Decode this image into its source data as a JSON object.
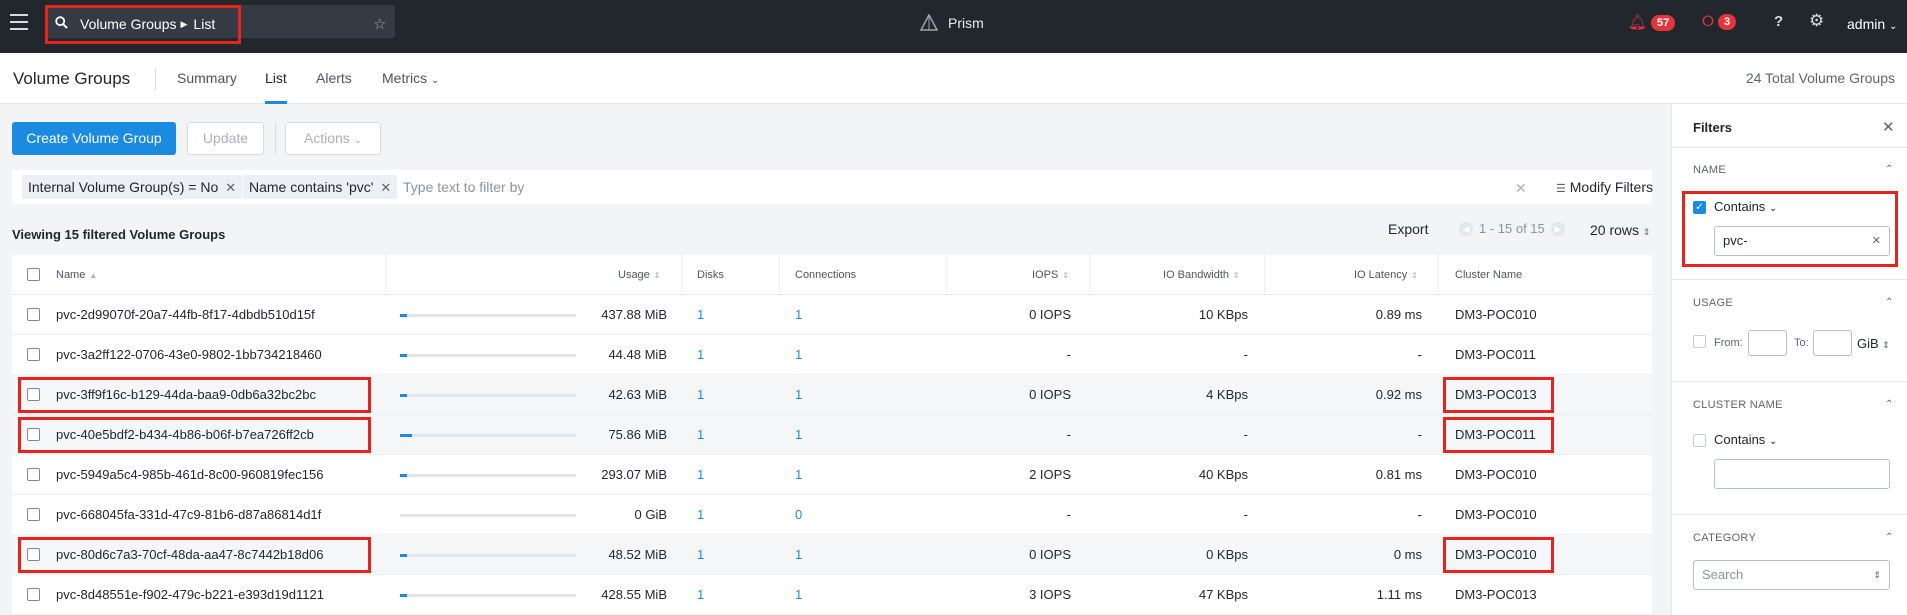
{
  "topbar": {
    "breadcrumb": {
      "section": "Volume Groups",
      "view": "List"
    },
    "brand": "Prism",
    "alerts_count": "57",
    "critical_count": "3",
    "user": "admin"
  },
  "subheader": {
    "title": "Volume Groups",
    "tabs": [
      {
        "label": "Summary",
        "active": false
      },
      {
        "label": "List",
        "active": true
      },
      {
        "label": "Alerts",
        "active": false
      },
      {
        "label": "Metrics",
        "active": false
      }
    ],
    "total": "24 Total Volume Groups"
  },
  "toolbar": {
    "create_label": "Create Volume Group",
    "update_label": "Update",
    "actions_label": "Actions"
  },
  "filterbar": {
    "chips": [
      {
        "label": "Internal Volume Group(s) = No"
      },
      {
        "label": "Name contains 'pvc'"
      }
    ],
    "placeholder": "Type text to filter by",
    "modify_label": "Modify Filters"
  },
  "listing": {
    "viewing": "Viewing 15 filtered Volume Groups",
    "export_label": "Export",
    "page_range": "1 - 15 of 15",
    "rows_label": "20 rows"
  },
  "table": {
    "headers": {
      "name": "Name",
      "usage": "Usage",
      "disks": "Disks",
      "connections": "Connections",
      "iops": "IOPS",
      "bandwidth": "IO Bandwidth",
      "latency": "IO Latency",
      "cluster": "Cluster Name"
    },
    "rows": [
      {
        "name": "pvc-2d99070f-20a7-44fb-8f17-4dbdb510d15f",
        "usage": "437.88 MiB",
        "usage_fill_pct": 4,
        "disks": "1",
        "connections": "1",
        "iops": "0 IOPS",
        "bandwidth": "10 KBps",
        "latency": "0.89 ms",
        "cluster": "DM3-POC010",
        "highlighted": false
      },
      {
        "name": "pvc-3a2ff122-0706-43e0-9802-1bb734218460",
        "usage": "44.48 MiB",
        "usage_fill_pct": 4,
        "disks": "1",
        "connections": "1",
        "iops": "-",
        "bandwidth": "-",
        "latency": "-",
        "cluster": "DM3-POC011",
        "highlighted": false
      },
      {
        "name": "pvc-3ff9f16c-b129-44da-baa9-0db6a32bc2bc",
        "usage": "42.63 MiB",
        "usage_fill_pct": 4,
        "disks": "1",
        "connections": "1",
        "iops": "0 IOPS",
        "bandwidth": "4 KBps",
        "latency": "0.92 ms",
        "cluster": "DM3-POC013",
        "highlighted": true
      },
      {
        "name": "pvc-40e5bdf2-b434-4b86-b06f-b7ea726ff2cb",
        "usage": "75.86 MiB",
        "usage_fill_pct": 7,
        "disks": "1",
        "connections": "1",
        "iops": "-",
        "bandwidth": "-",
        "latency": "-",
        "cluster": "DM3-POC011",
        "highlighted": true
      },
      {
        "name": "pvc-5949a5c4-985b-461d-8c00-960819fec156",
        "usage": "293.07 MiB",
        "usage_fill_pct": 4,
        "disks": "1",
        "connections": "1",
        "iops": "2 IOPS",
        "bandwidth": "40 KBps",
        "latency": "0.81 ms",
        "cluster": "DM3-POC010",
        "highlighted": false
      },
      {
        "name": "pvc-668045fa-331d-47c9-81b6-d87a86814d1f",
        "usage": "0 GiB",
        "usage_fill_pct": 0,
        "disks": "1",
        "connections": "0",
        "iops": "-",
        "bandwidth": "-",
        "latency": "-",
        "cluster": "DM3-POC010",
        "highlighted": false
      },
      {
        "name": "pvc-80d6c7a3-70cf-48da-aa47-8c7442b18d06",
        "usage": "48.52 MiB",
        "usage_fill_pct": 4,
        "disks": "1",
        "connections": "1",
        "iops": "0 IOPS",
        "bandwidth": "0 KBps",
        "latency": "0 ms",
        "cluster": "DM3-POC010",
        "highlighted": true
      },
      {
        "name": "pvc-8d48551e-f902-479c-b221-e393d19d1121",
        "usage": "428.55 MiB",
        "usage_fill_pct": 4,
        "disks": "1",
        "connections": "1",
        "iops": "3 IOPS",
        "bandwidth": "47 KBps",
        "latency": "1.11 ms",
        "cluster": "DM3-POC013",
        "highlighted": false
      }
    ]
  },
  "filters_panel": {
    "title": "Filters",
    "name_section": {
      "title": "NAME",
      "operator": "Contains",
      "value": "pvc-"
    },
    "usage_section": {
      "title": "USAGE",
      "from_label": "From:",
      "to_label": "To:",
      "unit": "GiB"
    },
    "cluster_section": {
      "title": "CLUSTER NAME",
      "operator": "Contains",
      "value": ""
    },
    "category_section": {
      "title": "CATEGORY",
      "placeholder": "Search"
    }
  }
}
